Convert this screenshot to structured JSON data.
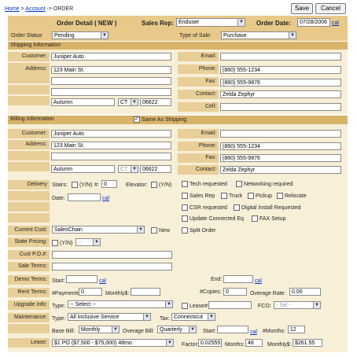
{
  "breadcrumb": {
    "home": "Home",
    "sep1": " > ",
    "account": "Account",
    "sep2": " -> ",
    "current": "ORDER"
  },
  "buttons": {
    "save": "Save",
    "cancel": "Cancel"
  },
  "header": {
    "title": "Order Detail ( NEW )",
    "sales_rep_label": "Sales Rep:",
    "sales_rep": "Enduser",
    "order_date_label": "Order Date:",
    "order_date": "07/28/2006",
    "cal": "cal"
  },
  "status": {
    "order_status_label": "Order Status",
    "order_status": "Pending",
    "type_of_sale_label": "Type of Sale:",
    "type_of_sale": "Purchase"
  },
  "shipping": {
    "section": "Shipping Information",
    "customer_label": "Customer:",
    "customer": "Juniper Auto",
    "address_label": "Address:",
    "address1": "123 Main St.",
    "address2": "",
    "address3": "",
    "city": "Autumn",
    "state": "CT",
    "zip": "06622",
    "email_label": "Email:",
    "email": "",
    "phone_label": "Phone:",
    "phone": "(860) 555-1234",
    "fax_label": "Fax:",
    "fax": "(860) 555-9876",
    "contact_label": "Contact:",
    "contact": "Zelda Zephyr",
    "cell_label": "Cell:",
    "cell": ""
  },
  "billing": {
    "section": "Billing Information",
    "same_as_shipping": "Same As Shipping",
    "customer_label": "Customer:",
    "customer": "Juniper Auto",
    "address_label": "Address:",
    "address1": "123 Main St.",
    "city": "Autumn",
    "state": "CT",
    "zip": "06622",
    "email_label": "Email:",
    "email": "",
    "phone_label": "Phone:",
    "phone": "(860) 555-1234",
    "fax_label": "Fax:",
    "fax": "(860) 555-9876",
    "contact_label": "Contact:",
    "contact": "Zelda Zephyr"
  },
  "delivery": {
    "label": "Delivery",
    "stairs": "Stairs:",
    "yn": "(Y/N)",
    "num": "#:",
    "num_val": "0",
    "elevator": "Elevator:",
    "date": "Date:",
    "cal": "cal",
    "opts": [
      "Tech requested",
      "Networking required",
      "Sales Rep",
      "Truck",
      "Pickup",
      "Relocate",
      "CSR requested",
      "Digital Install Requested",
      "Update Connected Eq",
      "FAX Setup",
      "Split Order"
    ]
  },
  "current_cust": {
    "label": "Current Cust:",
    "value": "SalesChain",
    "new": "New"
  },
  "state_pricing": {
    "label": "State Pricing:",
    "yn": "(Y/N)",
    "sel": "--"
  },
  "cust_po": {
    "label": "Cust P.O.#:"
  },
  "sale_terms": {
    "label": "Sale Terms:"
  },
  "demo_terms": {
    "label": "Demo Terms:",
    "start": "Start:",
    "end": "End:",
    "cal": "cal"
  },
  "rent_terms": {
    "label": "Rent Terms:",
    "payments": "#Payments:",
    "payments_val": "0",
    "monthly": "Monthly$:",
    "copies": "#Copies:",
    "copies_val": "0",
    "overage": "Overage Rate:",
    "overage_val": "0.00"
  },
  "upgrade": {
    "label": "Upgrade Info:",
    "type": "Type:",
    "type_val": "-- Select --",
    "lease": "Lease#:",
    "fco": "FCO:",
    "fco_val": "- Sel -"
  },
  "maintenance": {
    "label": "Maintenance:",
    "type": "Type:",
    "type_val": "All Inclusive Service",
    "tax": "Tax:",
    "tax_val": "Connecticut",
    "base_bill": "Base Bill:",
    "base_bill_val": "Monthly",
    "overage_bill": "Overage Bill:",
    "overage_bill_val": "Quarterly",
    "start": "Start:",
    "cal": "cal",
    "months": "#Months:",
    "months_val": "12"
  },
  "lease": {
    "label": "Lease:",
    "value": "$1 PO ($7,500 - $75,000) 48mo",
    "factor": "Factor:",
    "factor_val": "0.02555",
    "months": "Months:",
    "months_val": "48",
    "monthly": "Monthly$:",
    "monthly_val": "$261.55"
  },
  "colors": {
    "band": "#e8c98a",
    "section": "#d9b36a",
    "label": "#e8cf98",
    "cream": "#f7efd7",
    "link": "#0033cc"
  }
}
